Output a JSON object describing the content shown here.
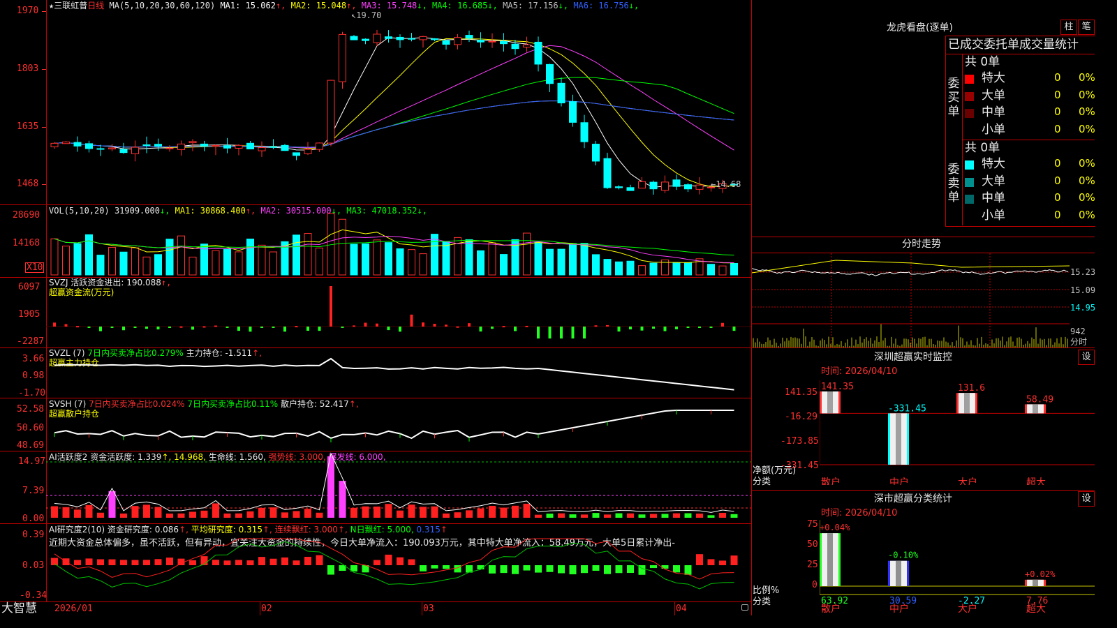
{
  "stock": {
    "name": "三联虹普",
    "period": "日线",
    "star": "★"
  },
  "ma_line": {
    "prefix": "MA(5,10,20,30,60,120)",
    "items": [
      {
        "label": "MA1: 15.062",
        "arrow": "↑",
        "color": "#ffffff"
      },
      {
        "label": "MA2: 15.048",
        "arrow": "↑",
        "color": "#ffff00"
      },
      {
        "label": "MA3: 15.748",
        "arrow": "↓",
        "color": "#ff40ff"
      },
      {
        "label": "MA4: 16.685",
        "arrow": "↓",
        "color": "#00ff00"
      },
      {
        "label": "MA5: 17.156",
        "arrow": "↓",
        "color": "#c0c0c0"
      },
      {
        "label": "MA6: 16.756",
        "arrow": "↓",
        "color": "#3060ff"
      }
    ]
  },
  "price_axis": [
    "1970",
    "1803",
    "1635",
    "1468"
  ],
  "price_annot": {
    "high": "19.70",
    "low": "14.68"
  },
  "vol": {
    "prefix": "VOL(5,10,20)",
    "value": "31909.000",
    "items": [
      {
        "label": "MA1: 30868.400",
        "arrow": "↑",
        "color": "#ffff00"
      },
      {
        "label": "MA2: 30515.000",
        "arrow": "↓",
        "color": "#ff40ff"
      },
      {
        "label": "MA3: 47018.352",
        "arrow": "↓",
        "color": "#00ff00"
      }
    ],
    "axis": [
      "28690",
      "14168"
    ],
    "unit": "X10"
  },
  "svzj": {
    "title": "SVZJ  活跃资金进出: 190.088",
    "arrow": "↑,",
    "sub": "超赢资金流(万元)",
    "axis": [
      "6097",
      "1905",
      "-2287"
    ]
  },
  "svzl": {
    "t1": "SVZL (7)",
    "t2": "7日内买卖净占比0.279%",
    "t3": "主力持仓: -1.511",
    "arrow": "↑,",
    "sub": "超赢主力持仓",
    "axis": [
      "3.66",
      "0.98",
      "-1.70"
    ]
  },
  "svsh": {
    "t1": "SVSH (7)",
    "t2": "7日内买卖净占比0.024%",
    "t3": "7日内买卖净占比0.11%",
    "t4": "散户持仓: 52.417",
    "arrow": "↑,",
    "sub": "超赢散户持仓",
    "axis": [
      "52.58",
      "50.60",
      "48.69"
    ]
  },
  "ai_active": {
    "t1": "AI活跃度2",
    "t2": "资金活跃度: 1.339",
    "t3": "↑, 14.968,",
    "t4": "生命线: 1.560,",
    "t5": "强势线: 3.000,",
    "t6": "爆发线: 6.000,",
    "axis": [
      "14.97",
      "7.39",
      "0.00"
    ]
  },
  "ai_research": {
    "t1": "AI研究度2(10)",
    "t2": "资金研究度: 0.086",
    "t3": "平均研究度: 0.315",
    "t4": "连续飘红: 3.000",
    "t5": "N日飘红: 5.000,",
    "t6": "0.315",
    "axis": [
      "0.39",
      "0.03",
      "-0.34"
    ]
  },
  "comment": "近期大资金总体偏多，虽不活跃，但有异动，宜关注大资金的持续性，今日大单净流入：190.093万元，其中特大单净流入：58.49万元，大单5日累计净出-",
  "date_axis": [
    "2026/01",
    "02",
    "03",
    "04"
  ],
  "brand": "大智慧",
  "dragon": {
    "title": "龙虎看盘(逐单)",
    "btn1": "柱",
    "btn2": "笔",
    "header": "已成交委托单成交量统计",
    "buy_label": "委买单",
    "sell_label": "委卖单",
    "buy_total": "共 0单",
    "sell_total": "共 0单",
    "buy_rows": [
      {
        "name": "特大",
        "count": "0",
        "pct": "0%",
        "color": "#ff0000"
      },
      {
        "name": "大单",
        "count": "0",
        "pct": "0%",
        "color": "#9a0000"
      },
      {
        "name": "中单",
        "count": "0",
        "pct": "0%",
        "color": "#6a0000"
      },
      {
        "name": "小单",
        "count": "0",
        "pct": "0%",
        "color": "#000000"
      }
    ],
    "sell_rows": [
      {
        "name": "特大",
        "count": "0",
        "pct": "0%",
        "color": "#00ffff"
      },
      {
        "name": "大单",
        "count": "0",
        "pct": "0%",
        "color": "#009090"
      },
      {
        "name": "中单",
        "count": "0",
        "pct": "0%",
        "color": "#006868"
      },
      {
        "name": "小单",
        "count": "0",
        "pct": "0%",
        "color": "#000000"
      }
    ]
  },
  "intraday": {
    "title": "分时走势",
    "axis": [
      "15.23",
      "15.09",
      "14.95"
    ],
    "vol": "942",
    "unit": "分时"
  },
  "monitor": {
    "title": "深圳超赢实时监控",
    "btn": "设",
    "time": "时间: 2026/04/10",
    "axis": [
      "141.35",
      "-16.29",
      "-173.85",
      "-331.45"
    ],
    "left_label1": "净额(万元)",
    "left_label2": "分类",
    "cats": [
      "散户",
      "中户",
      "大户",
      "超大"
    ],
    "values": [
      141.35,
      -331.45,
      131.6,
      58.49
    ],
    "value_labels": [
      "141.35",
      "-331.45",
      "131.6",
      "58.49"
    ]
  },
  "classify": {
    "title": "深市超赢分类统计",
    "btn": "设",
    "time": "时间: 2026/04/10",
    "axis": [
      "75",
      "50",
      "25",
      "0"
    ],
    "left_label1": "比例%",
    "left_label2": "分类",
    "cats": [
      "散户",
      "中户",
      "大户",
      "超大"
    ],
    "values": [
      63.92,
      30.59,
      -2.27,
      7.76
    ],
    "value_labels": [
      "63.92",
      "30.59",
      "-2.27",
      "7.76"
    ],
    "delta_labels": [
      "+0.04%",
      "-0.10%",
      "",
      "+0.02%"
    ]
  }
}
